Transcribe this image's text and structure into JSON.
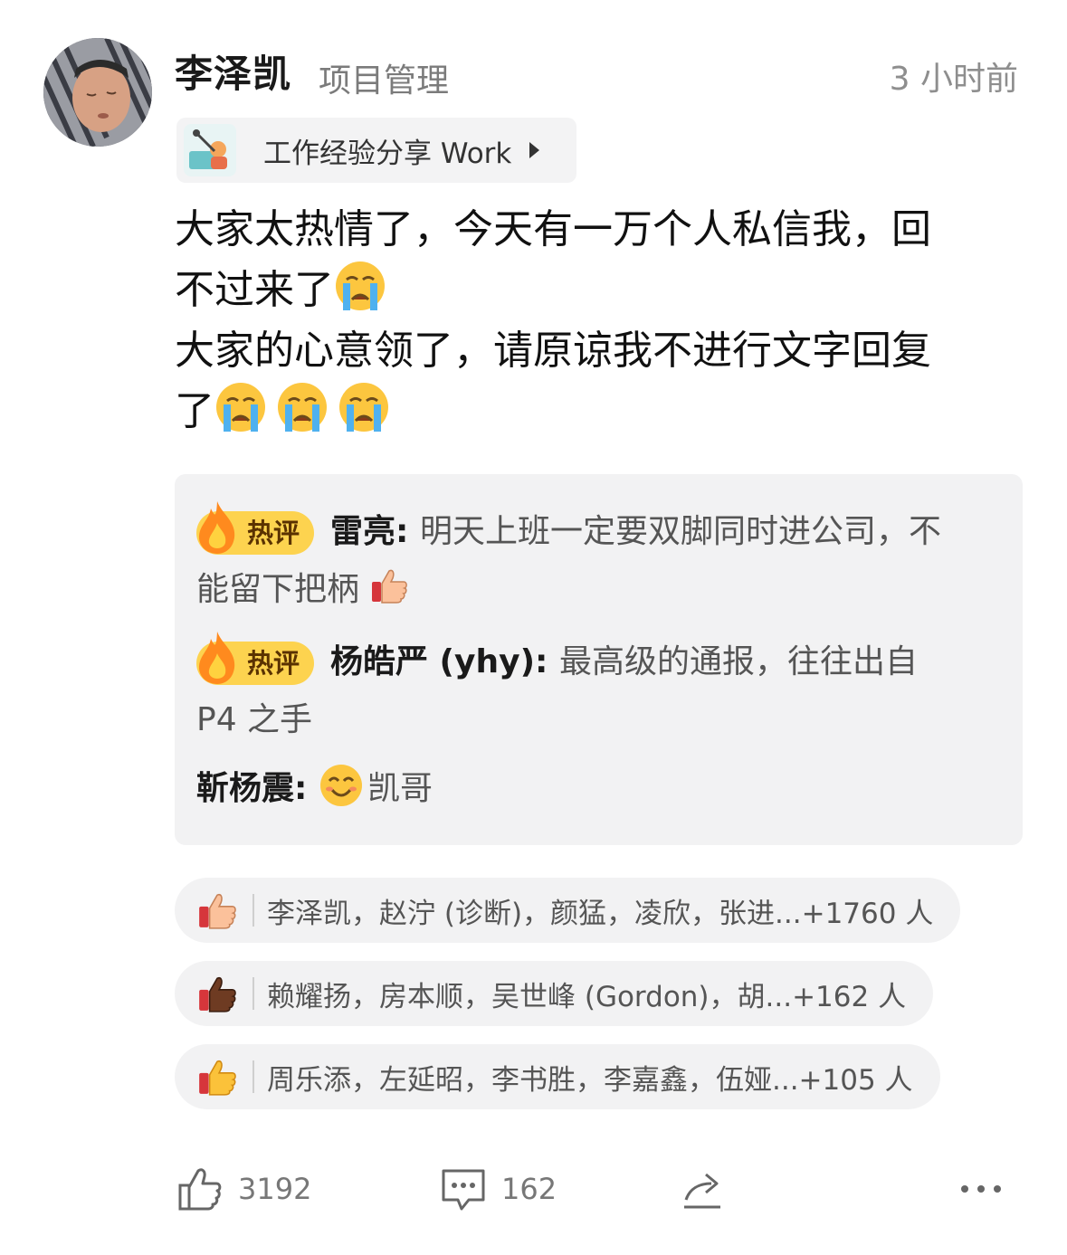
{
  "post": {
    "author": "李泽凯",
    "author_title": "项目管理",
    "time": "3 小时前",
    "channel": "工作经验分享 Work",
    "text_lines": [
      "大家太热情了，今天有一万个人私信我，回",
      "不过来了",
      "大家的心意领了，请原谅我不进行文字回复",
      "了"
    ]
  },
  "hot_comments": {
    "badge_label": "热评",
    "items": [
      {
        "author": "雷亮",
        "sep": ": ",
        "text_line1": "明天上班一定要双脚同时进公司，不",
        "text_line2": "能留下把柄"
      },
      {
        "author": "杨皓严 (yhy)",
        "sep": ": ",
        "text_line1": "最高级的通报，往往出自",
        "text_line2": "P4 之手"
      },
      {
        "author": "靳杨震",
        "sep": ": ",
        "text": "凯哥"
      }
    ]
  },
  "reactions": [
    {
      "icon": "thumbs-up-light-icon",
      "text": "李泽凯，赵泞 (诊断)，颜猛，凌欣，张进...+1760 人"
    },
    {
      "icon": "thumbs-up-dark-icon",
      "text": "赖耀扬，房本顺，吴世峰 (Gordon)，胡...+162 人"
    },
    {
      "icon": "thumbs-up-yellow-icon",
      "text": "周乐添，左延昭，李书胜，李嘉鑫，伍娅...+105 人"
    }
  ],
  "toolbar": {
    "like_count": "3192",
    "comment_count": "162"
  },
  "colors": {
    "hot_badge": "#fdd34f",
    "panel_bg": "#f2f2f3",
    "muted_text": "#7b7b7b"
  }
}
